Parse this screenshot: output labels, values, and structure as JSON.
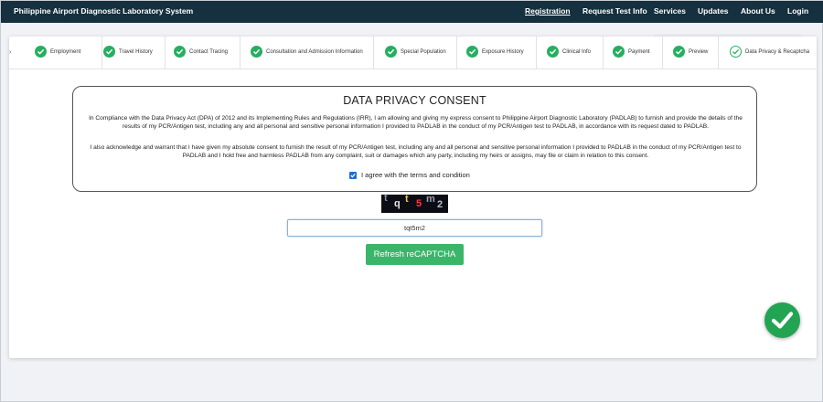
{
  "navbar": {
    "brand": "Philippine Airport Diagnostic Laboratory System",
    "items": [
      {
        "label": "Registration",
        "active": true
      },
      {
        "label": "Request Test Info"
      },
      {
        "label": "Services"
      },
      {
        "label": "Updates"
      },
      {
        "label": "About Us"
      },
      {
        "label": "Login"
      }
    ]
  },
  "steps": {
    "prev_arrow": "›",
    "items": [
      {
        "label": "Employment",
        "status": "done"
      },
      {
        "label": "Travel History",
        "status": "done"
      },
      {
        "label": "Contact Tracing",
        "status": "done"
      },
      {
        "label": "Consultation and Admission Information",
        "status": "done"
      },
      {
        "label": "Special Population",
        "status": "done"
      },
      {
        "label": "Exposure History",
        "status": "done"
      },
      {
        "label": "Clinical Info",
        "status": "done"
      },
      {
        "label": "Payment",
        "status": "done"
      },
      {
        "label": "Preview",
        "status": "done"
      },
      {
        "label": "Data Privacy & Recaptcha",
        "status": "current"
      }
    ]
  },
  "consent": {
    "title": "DATA PRIVACY CONSENT",
    "paragraph1": "In Compliance with the Data Privacy Act (DPA) of 2012 and its Implementing Rules and Regulations (IRR), I am allowing and giving my express consent to Philippine Airport Diagnostic Laboratory (PADLAB) to furnish and provide the details of the results of my PCR/Antigen test, including any and all personal and sensitive personal information I provided to PADLAB in the conduct of my PCR/Antigen test to PADLAB, in accordance with its request dated to PADLAB.",
    "paragraph2": "I also acknowledge and warrant that I have given my absolute consent to furnish the result of my PCR/Antigen test, including any and all personal and sensitive personal information I provided to PADLAB in the conduct of my PCR/Antigen test to PADLAB and I hold free and harmless PADLAB from any complaint, suit or damages which any party, including my heirs or assigns, may file or claim in relation to this consent.",
    "agree_label": "I agree with the terms and condition",
    "agree_checked": true
  },
  "captcha": {
    "chars": [
      "t",
      "q",
      "t",
      "5",
      "m",
      "2"
    ],
    "input_value": "tqt5m2",
    "refresh_label": "Refresh reCAPTCHA"
  },
  "colors": {
    "navbar": "#15303f",
    "check_green": "#27ae60",
    "button_green": "#3bb56a",
    "checkbox_blue": "#1f6fd1"
  },
  "icons": {
    "step_check": "check-circle-icon",
    "success_badge": "check-badge-icon"
  }
}
